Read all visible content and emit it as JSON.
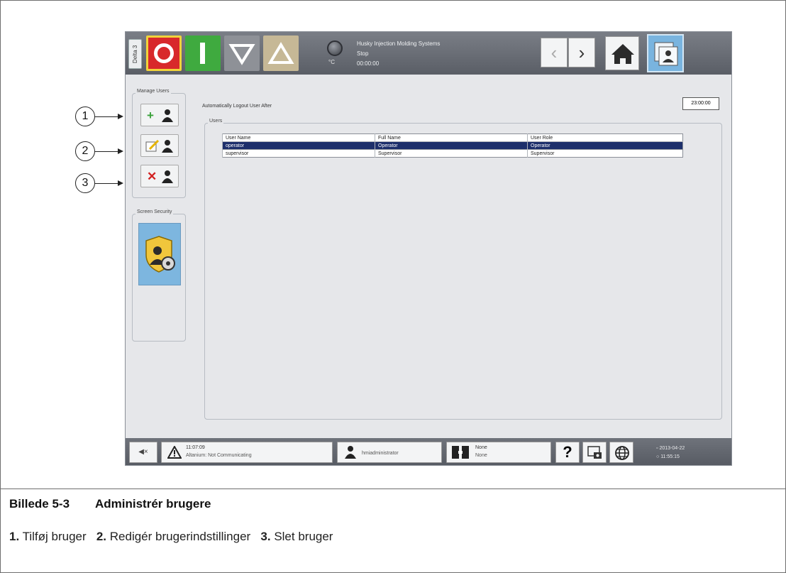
{
  "screen": {
    "control_tab": "Delta 3",
    "status_title": "Husky Injection Molding Systems",
    "status_state": "Stop",
    "status_timer": "00:00:00",
    "status_unit": "°C",
    "manage_users_label": "Manage Users",
    "screen_security_label": "Screen Security",
    "auto_logout_label": "Automatically Logout User After",
    "auto_logout_value": "23:00:00",
    "users_label": "Users",
    "table": {
      "headers": [
        "User Name",
        "Full Name",
        "User Role"
      ],
      "rows": [
        [
          "operator",
          "Operator",
          "Operator"
        ],
        [
          "supervisor",
          "Supervisor",
          "Supervisor"
        ]
      ]
    },
    "bottom": {
      "alarm_time": "11:07:09",
      "alarm_text": "Altanium: Not Communicating",
      "user": "hmiadministrator",
      "mold_line1": "None",
      "mold_line2": "None",
      "help": "?",
      "date": "2013-04-22",
      "time": "11:55:15"
    }
  },
  "callouts": [
    "1",
    "2",
    "3"
  ],
  "caption": {
    "figure_number": "Billede 5-3",
    "figure_title": "Administrér brugere",
    "legend": [
      {
        "num": "1.",
        "text": "Tilføj bruger"
      },
      {
        "num": "2.",
        "text": "Redigér brugerindstillinger"
      },
      {
        "num": "3.",
        "text": "Slet bruger"
      }
    ]
  },
  "colors": {
    "stop": "#d8282b",
    "start": "#3faa3f",
    "selected_row": "#1d2f6b",
    "accent": "#79b4df"
  }
}
